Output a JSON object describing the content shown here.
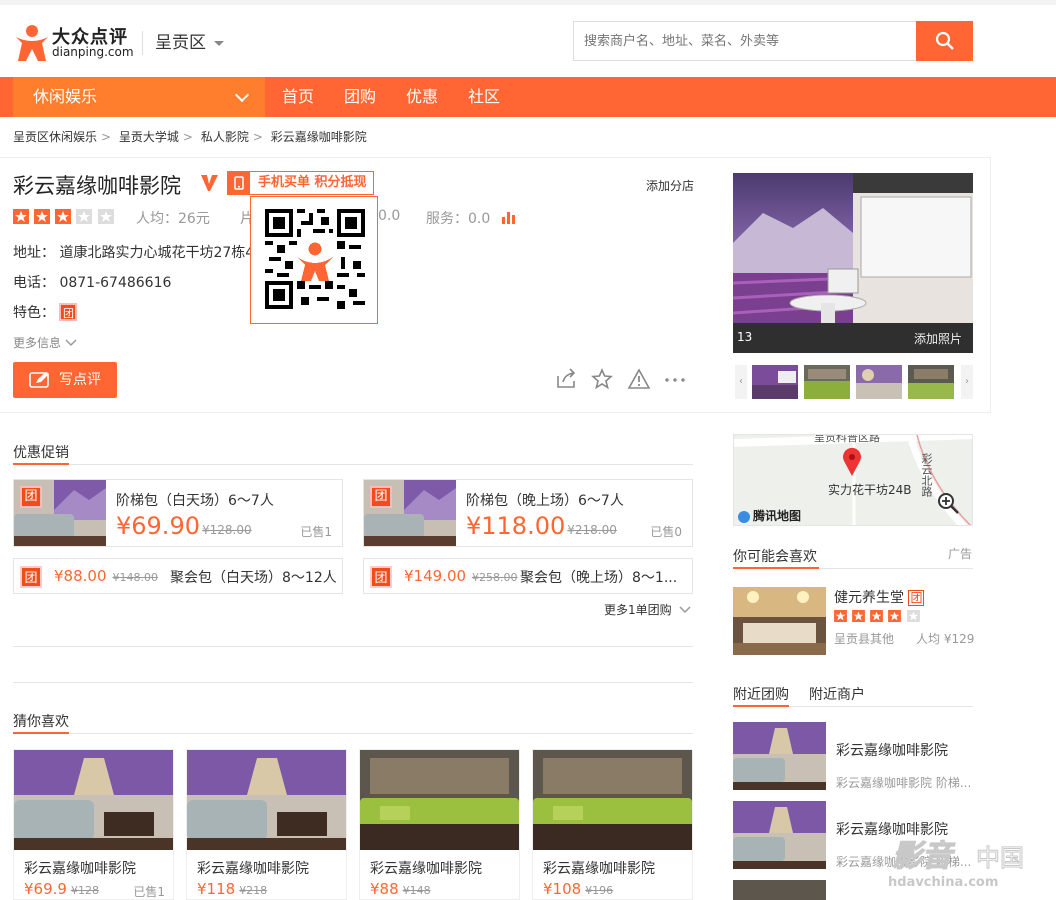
{
  "brand": {
    "cn": "大众点评",
    "en": "dianping.com"
  },
  "city": "呈贡区",
  "search": {
    "placeholder": "搜索商户名、地址、菜名、外卖等"
  },
  "nav": {
    "category": "休闲娱乐",
    "links": [
      "首页",
      "团购",
      "优惠",
      "社区"
    ]
  },
  "breadcrumb": [
    "呈贡区休闲娱乐",
    "呈贡大学城",
    "私人影院",
    "彩云嘉缘咖啡影院"
  ],
  "shop": {
    "name": "彩云嘉缘咖啡影院",
    "mobile_tag": "手机买单 积分抵现",
    "add_branch": "添加分店",
    "avg_price": "人均：26元",
    "rating_mid": "片",
    "rating_mid_value": "0.0",
    "service": "服务：0.0",
    "stars": 3,
    "address_label": "地址：",
    "address": "道康北路实力心城花干坊27栋4",
    "phone_label": "电话：",
    "phone": "0871-67486616",
    "feature_label": "特色：",
    "feature_icon": "团",
    "more_info": "更多信息",
    "write_review": "写点评",
    "photo_count": "13",
    "add_photo": "添加照片"
  },
  "promo": {
    "title": "优惠促销",
    "deals": [
      {
        "title": "阶梯包（白天场）6～7人",
        "price": "¥69.90",
        "orig": "¥128.00",
        "sold": "已售1"
      },
      {
        "title": "阶梯包（晚上场）6～7人",
        "price": "¥118.00",
        "orig": "¥218.00",
        "sold": "已售0"
      }
    ],
    "small_deals": [
      {
        "tag": "团",
        "price": "¥88.00",
        "orig": "¥148.00",
        "name": "聚会包（白天场）8～12人"
      },
      {
        "tag": "团",
        "price": "¥149.00",
        "orig": "¥258.00",
        "name": "聚会包（晚上场）8～1..."
      }
    ],
    "more": "更多1单团购"
  },
  "guess": {
    "title": "猜你喜欢",
    "items": [
      {
        "name": "彩云嘉缘咖啡影院",
        "price": "¥69.9",
        "orig": "¥128",
        "sold": "已售1"
      },
      {
        "name": "彩云嘉缘咖啡影院",
        "price": "¥118",
        "orig": "¥218",
        "sold": ""
      },
      {
        "name": "彩云嘉缘咖啡影院",
        "price": "¥88",
        "orig": "¥148",
        "sold": ""
      },
      {
        "name": "彩云嘉缘咖啡影院",
        "price": "¥108",
        "orig": "¥196",
        "sold": ""
      }
    ]
  },
  "map": {
    "label": "实力花干坊24B",
    "road_top": "呈贡科普区路",
    "road_right": "彩云北路",
    "brand": "腾讯地图"
  },
  "side": {
    "maybe_like": "你可能会喜欢",
    "ad": "广告",
    "rec": {
      "name": "健元养生堂",
      "tag": "团",
      "area": "呈贡县其他",
      "avg": "人均 ¥129",
      "stars": 4
    },
    "tabs": [
      "附近团购",
      "附近商户"
    ],
    "nearby": [
      {
        "name": "彩云嘉缘咖啡影院",
        "sub": "彩云嘉缘咖啡影院 阶梯..."
      },
      {
        "name": "彩云嘉缘咖啡影院",
        "sub": "彩云嘉缘咖啡影院 阶梯..."
      }
    ]
  },
  "watermark": {
    "cn": "影音中国",
    "en": "hdavchina.com"
  },
  "colors": {
    "brand": "#ff6633",
    "text": "#333333",
    "muted": "#999999"
  }
}
